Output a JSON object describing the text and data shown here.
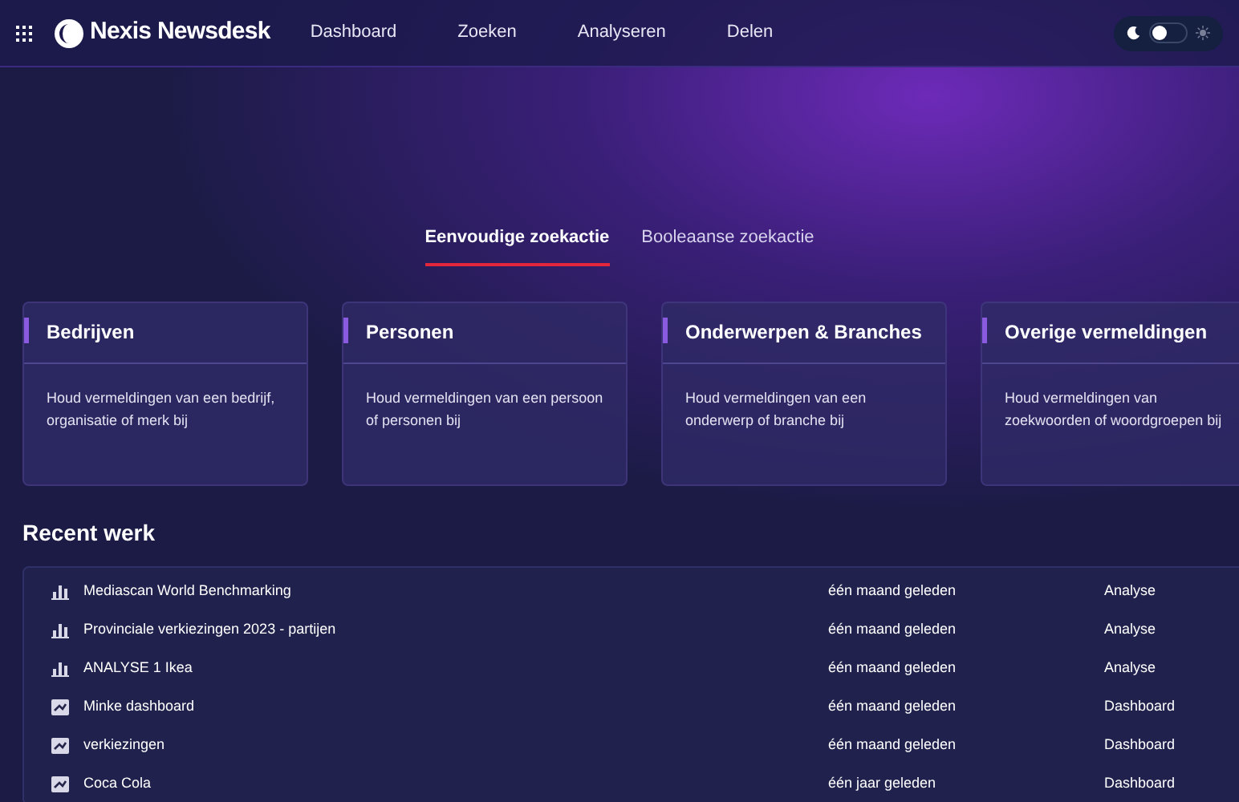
{
  "nav": {
    "brand": "Nexis Newsdesk",
    "items": [
      "Dashboard",
      "Zoeken",
      "Analyseren",
      "Delen"
    ]
  },
  "theme_toggle": {
    "dark": true
  },
  "search_tabs": [
    {
      "label": "Eenvoudige zoekactie",
      "selected": true
    },
    {
      "label": "Booleaanse zoekactie",
      "selected": false
    }
  ],
  "cards": [
    {
      "title": "Bedrijven",
      "description": "Houd vermeldingen van een bedrijf, organisatie of merk bij"
    },
    {
      "title": "Personen",
      "description": "Houd vermeldingen van een persoon of personen bij"
    },
    {
      "title": "Onderwerpen & Branches",
      "description": "Houd vermeldingen van een onderwerp of branche bij"
    },
    {
      "title": "Overige vermeldingen",
      "description": "Houd vermeldingen van zoekwoorden of woordgroepen bij"
    }
  ],
  "recent": {
    "title": "Recent werk",
    "rows": [
      {
        "kind": "analysis",
        "name": "Mediascan World Benchmarking",
        "time": "één maand geleden",
        "type": "Analyse"
      },
      {
        "kind": "analysis",
        "name": "Provinciale verkiezingen 2023 - partijen",
        "time": "één maand geleden",
        "type": "Analyse"
      },
      {
        "kind": "analysis",
        "name": "ANALYSE 1 Ikea",
        "time": "één maand geleden",
        "type": "Analyse"
      },
      {
        "kind": "dashboard",
        "name": "Minke dashboard",
        "time": "één maand geleden",
        "type": "Dashboard"
      },
      {
        "kind": "dashboard",
        "name": "verkiezingen",
        "time": "één maand geleden",
        "type": "Dashboard"
      },
      {
        "kind": "dashboard",
        "name": "Coca Cola",
        "time": "één jaar geleden",
        "type": "Dashboard"
      }
    ]
  }
}
